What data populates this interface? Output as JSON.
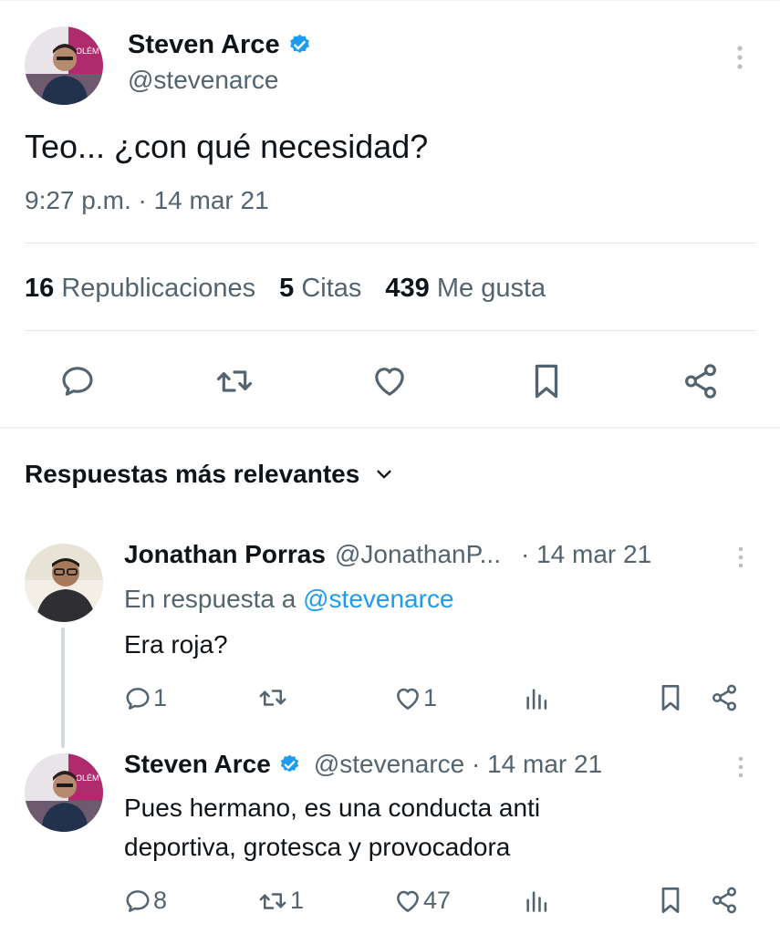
{
  "main_tweet": {
    "author_name": "Steven Arce",
    "handle": "@stevenarce",
    "avatar_text": "OLÉM",
    "text": "Teo... ¿con qué necesidad?",
    "timestamp": "9:27 p.m. · 14 mar 21",
    "stats": {
      "reposts_count": "16",
      "reposts_label": "Republicaciones",
      "quotes_count": "5",
      "quotes_label": "Citas",
      "likes_count": "439",
      "likes_label": "Me gusta"
    }
  },
  "replies_header": {
    "label": "Respuestas más relevantes"
  },
  "replies": [
    {
      "author_name": "Jonathan Porras",
      "handle": "@JonathanP...",
      "date": "· 14 mar 21",
      "reply_to_prefix": "En respuesta a",
      "reply_to_handle": "@stevenarce",
      "text": "Era roja?",
      "reply_count": "1",
      "repost_count": "",
      "like_count": "1"
    },
    {
      "author_name": "Steven Arce",
      "handle": "@stevenarce · 14 mar 21",
      "avatar_text": "OLÉM",
      "text_line1": "Pues hermano, es una conducta anti",
      "text_line2": "deportiva, grotesca y provocadora",
      "reply_count": "8",
      "repost_count": "1",
      "like_count": "47"
    }
  ],
  "colors": {
    "text": "#0f1419",
    "muted": "#536471",
    "link": "#1d9bf0",
    "verified": "#1d9bf0",
    "divider": "#e4e8ea"
  },
  "icons": [
    "more-vertical-icon",
    "verified-badge-icon",
    "reply-icon",
    "repost-icon",
    "like-icon",
    "bookmark-icon",
    "share-icon",
    "views-icon",
    "chevron-down-icon"
  ]
}
